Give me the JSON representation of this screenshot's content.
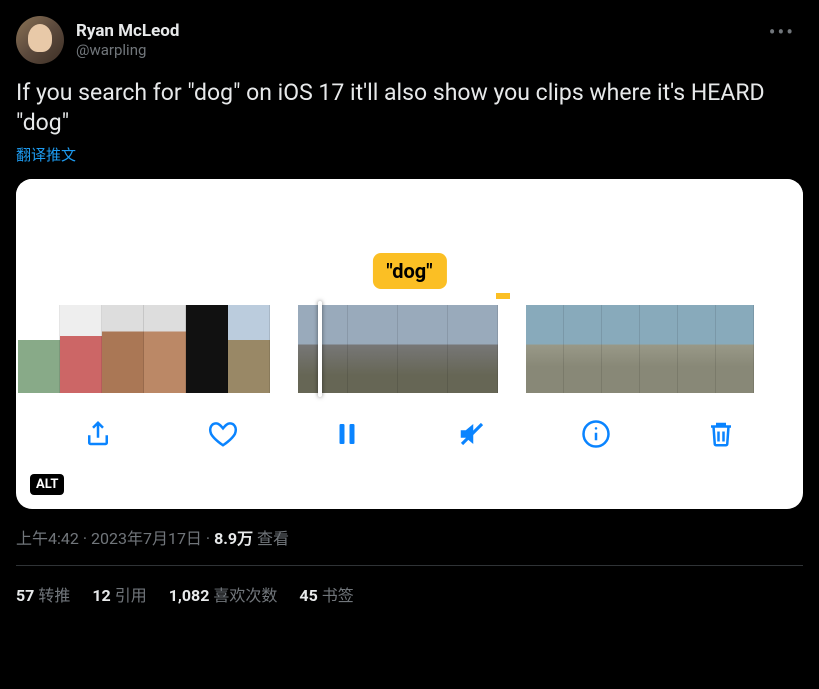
{
  "header": {
    "display_name": "Ryan McLeod",
    "handle": "@warpling"
  },
  "body": "If you search for \"dog\" on iOS 17 it'll also show you clips where it's HEARD \"dog\"",
  "translate_label": "翻译推文",
  "media": {
    "bubble_text": "\"dog\"",
    "alt_badge": "ALT"
  },
  "meta": {
    "time": "上午4:42",
    "dot1": " · ",
    "date": "2023年7月17日",
    "dot2": " · ",
    "view_count": "8.9万",
    "view_label": " 查看"
  },
  "stats": {
    "retweets": {
      "count": "57",
      "label": "转推"
    },
    "quotes": {
      "count": "12",
      "label": "引用"
    },
    "likes": {
      "count": "1,082",
      "label": "喜欢次数"
    },
    "bookmarks": {
      "count": "45",
      "label": "书签"
    }
  }
}
